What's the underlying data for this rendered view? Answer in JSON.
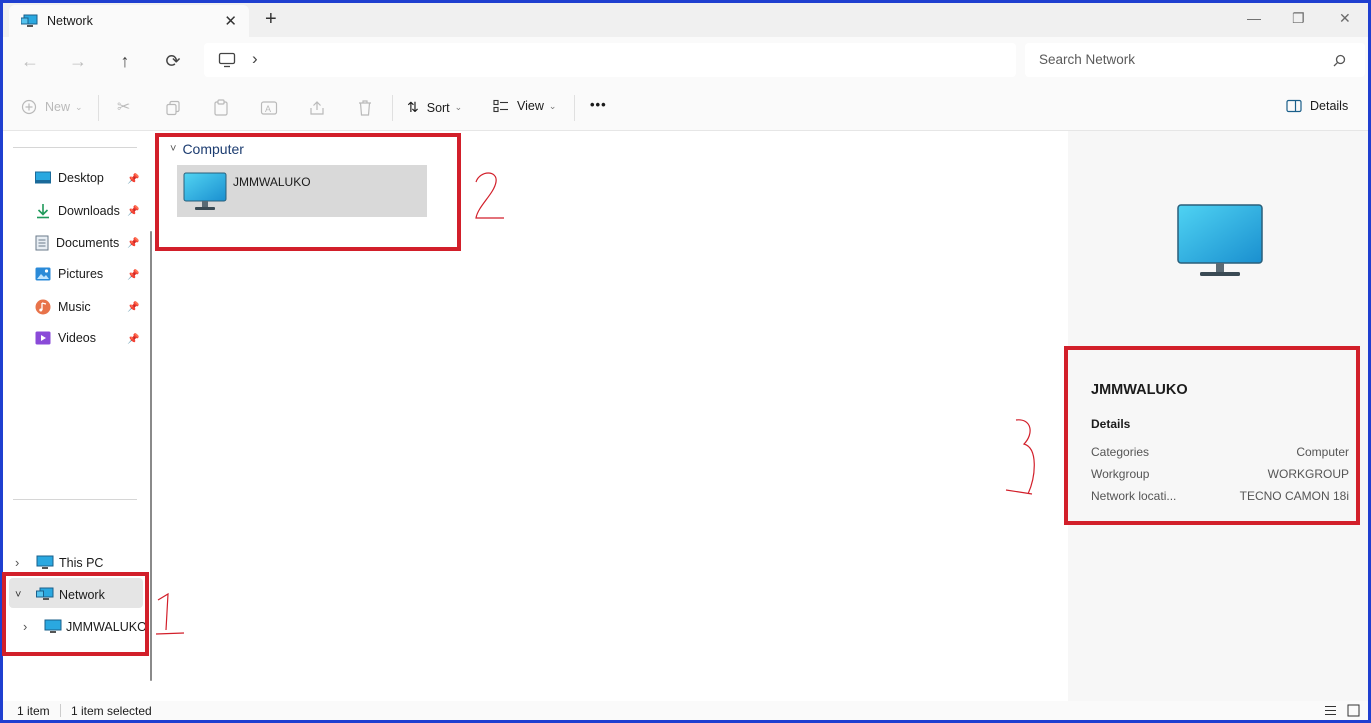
{
  "window": {
    "tab_title": "Network",
    "tab_close": "✕",
    "new_tab": "+",
    "minimize": "—",
    "maximize": "❐",
    "close": "✕"
  },
  "navbar": {
    "back": "←",
    "forward": "→",
    "up": "↑",
    "refresh": "⟳",
    "address_chevron": "›",
    "search_placeholder": "Search Network"
  },
  "commands": {
    "new_label": "New",
    "sort_label": "Sort",
    "view_label": "View",
    "more_label": "•••",
    "details_label": "Details"
  },
  "sidebar": {
    "quick_access": [
      {
        "label": "Desktop",
        "icon": "desktop-icon"
      },
      {
        "label": "Downloads",
        "icon": "downloads-icon"
      },
      {
        "label": "Documents",
        "icon": "documents-icon"
      },
      {
        "label": "Pictures",
        "icon": "pictures-icon"
      },
      {
        "label": "Music",
        "icon": "music-icon"
      },
      {
        "label": "Videos",
        "icon": "videos-icon"
      }
    ],
    "this_pc": "This PC",
    "network": "Network",
    "network_child": "JMMWALUKO"
  },
  "content": {
    "group_title": "Computer",
    "items": [
      {
        "name": "JMMWALUKO",
        "icon": "computer-icon"
      }
    ]
  },
  "details": {
    "title": "JMMWALUKO",
    "section": "Details",
    "rows": [
      {
        "label": "Categories",
        "value": "Computer"
      },
      {
        "label": "Workgroup",
        "value": "WORKGROUP"
      },
      {
        "label": "Network locati...",
        "value": "TECNO CAMON 18i"
      }
    ]
  },
  "status": {
    "item_count": "1 item",
    "selected": "1 item selected"
  },
  "colors": {
    "annotation_red": "#d21f2a",
    "window_border": "#1f3fd0",
    "monitor_blue": "#27b6e6"
  }
}
